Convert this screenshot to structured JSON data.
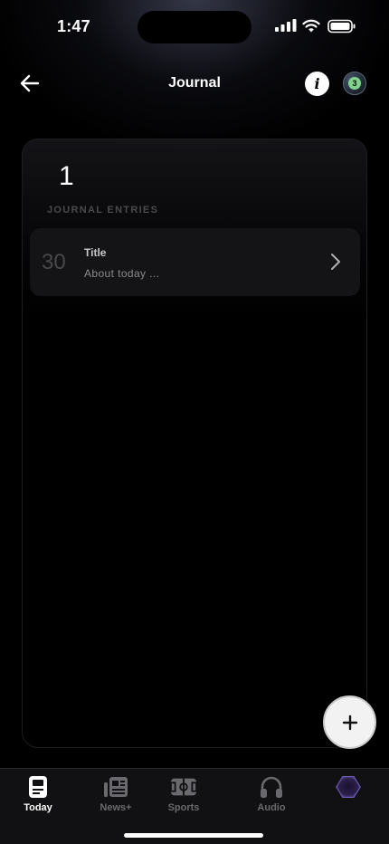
{
  "status_bar": {
    "time": "1:47"
  },
  "nav": {
    "title": "Journal",
    "info_label": "i",
    "badge_count": "3"
  },
  "journal": {
    "entry_count": "1",
    "section_label": "JOURNAL ENTRIES",
    "entries": [
      {
        "day": "30",
        "title": "Title",
        "subtitle": "About today ..."
      }
    ]
  },
  "tab_bar": {
    "tabs": [
      {
        "label": "Today",
        "icon": "today-icon",
        "active": true
      },
      {
        "label": "News+",
        "icon": "news-icon",
        "active": false
      },
      {
        "label": "Sports",
        "icon": "sports-icon",
        "active": false
      },
      {
        "label": "Audio",
        "icon": "headphones-icon",
        "active": false
      },
      {
        "label": "",
        "icon": "profile-hex-icon",
        "active": false
      }
    ]
  },
  "colors": {
    "background": "#000000",
    "badge_green": "#7fd38c",
    "card_row": "#141416",
    "tab_bar": "#111113"
  }
}
